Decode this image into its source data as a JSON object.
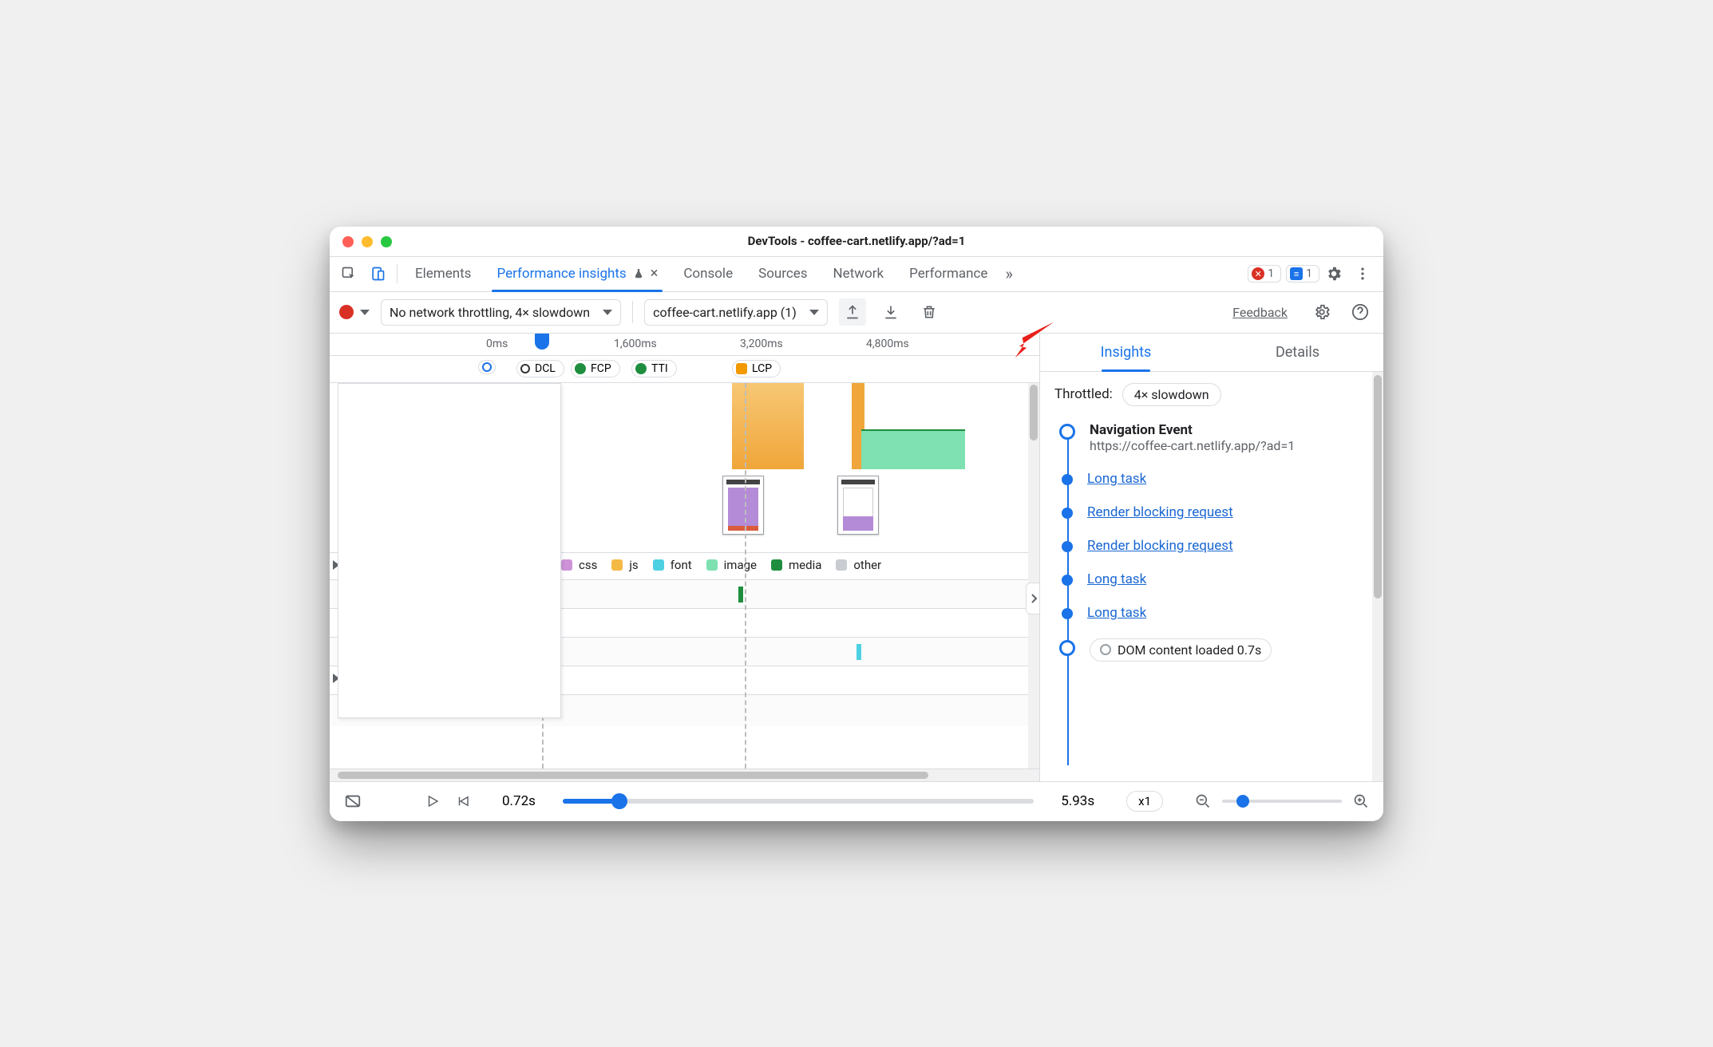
{
  "window_title": "DevTools - coffee-cart.netlify.app/?ad=1",
  "tabs": {
    "elements": "Elements",
    "perf_insights": "Performance insights",
    "console": "Console",
    "sources": "Sources",
    "network": "Network",
    "performance": "Performance"
  },
  "more_tabs_glyph": "»",
  "error_badge_count": "1",
  "info_badge_count": "1",
  "toolbar": {
    "throttle_select": "No network throttling, 4× slowdown",
    "page_select": "coffee-cart.netlify.app (1)",
    "feedback": "Feedback"
  },
  "timeline": {
    "ticks": [
      "0ms",
      "1,600ms",
      "3,200ms",
      "4,800ms"
    ],
    "markers": {
      "dcl": "DCL",
      "fcp": "FCP",
      "tti": "TTI",
      "lcp": "LCP"
    }
  },
  "legend": {
    "css": "css",
    "js": "js",
    "font": "font",
    "image": "image",
    "media": "media",
    "other": "other"
  },
  "colors": {
    "css": "#ce93d8",
    "js": "#f5b946",
    "font": "#4dd0e1",
    "image": "#7fe1b2",
    "media": "#1e8e3e",
    "other": "#c9ccd1",
    "accent": "#1a73e8"
  },
  "right": {
    "tab_insights": "Insights",
    "tab_details": "Details",
    "throttled_label": "Throttled:",
    "throttled_value": "4× slowdown",
    "nav_title": "Navigation Event",
    "nav_url": "https://coffee-cart.netlify.app/?ad=1",
    "items": [
      "Long task",
      "Render blocking request",
      "Render blocking request",
      "Long task",
      "Long task"
    ],
    "dom_loaded": "DOM content loaded 0.7s"
  },
  "footer": {
    "time_current": "0.72s",
    "time_end": "5.93s",
    "speed": "x1"
  }
}
